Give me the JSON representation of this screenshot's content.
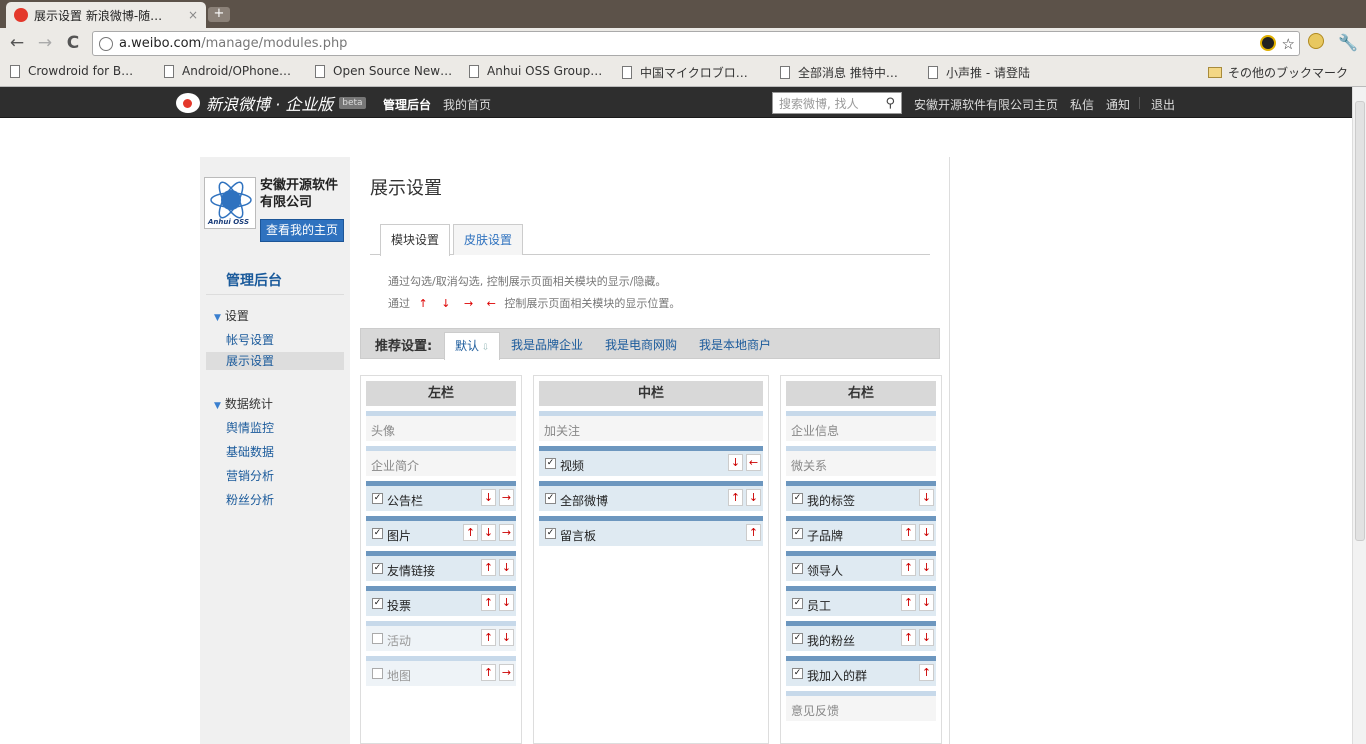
{
  "browser": {
    "tab_title": "展示设置 新浪微博-随…",
    "tab_close": "×",
    "new_tab": "+",
    "back": "←",
    "forward": "→",
    "reload": "C",
    "url_host": "a.weibo.com",
    "url_path": "/manage/modules.php",
    "star": "☆",
    "wrench": "🔧",
    "bookmarks": [
      "Crowdroid for B…",
      "Android/OPhone…",
      "Open Source New…",
      "Anhui OSS Group…",
      "中国マイクロブロ…",
      "全部消息 推特中…",
      "小声推 - 请登陆"
    ],
    "other_bookmarks": "その他のブックマーク"
  },
  "weibo_bar": {
    "brand": "新浪微博 · 企业版",
    "beta": "beta",
    "admin": "管理后台",
    "my_home": "我的首页",
    "search_placeholder": "搜索微博, 找人",
    "company_home": "安徽开源软件有限公司主页",
    "messages": "私信",
    "notices": "通知",
    "logout": "退出"
  },
  "sidebar": {
    "company_name": "安徽开源软件有限公司",
    "logo_text": "Anhui OSS",
    "view_home": "查看我的主页",
    "heading": "管理后台",
    "group1": "设置",
    "group1_items": [
      "帐号设置",
      "展示设置"
    ],
    "group2": "数据统计",
    "group2_items": [
      "舆情监控",
      "基础数据",
      "营销分析",
      "粉丝分析"
    ]
  },
  "main": {
    "title": "展示设置",
    "tabs": [
      "模块设置",
      "皮肤设置"
    ],
    "hint1": "通过勾选/取消勾选, 控制展示页面相关模块的显示/隐藏。",
    "hint2_prefix": "通过",
    "hint2_arrows": [
      "↑",
      "↓",
      "→",
      "←"
    ],
    "hint2_suffix": "控制展示页面相关模块的显示位置。",
    "preset_label": "推荐设置:",
    "presets": [
      "默认",
      "我是品牌企业",
      "我是电商网购",
      "我是本地商户"
    ]
  },
  "columns": {
    "left_title": "左栏",
    "mid_title": "中栏",
    "right_title": "右栏"
  }
}
